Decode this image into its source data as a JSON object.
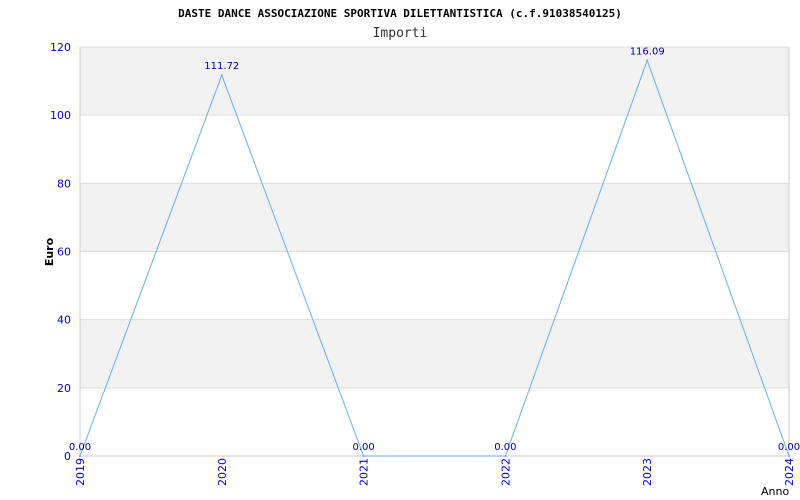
{
  "chart_data": {
    "type": "line",
    "title": "DASTE DANCE ASSOCIAZIONE SPORTIVA DILETTANTISTICA (c.f.91038540125)",
    "subtitle": "Importi",
    "xlabel": "Anno",
    "ylabel": "Euro",
    "categories": [
      "2019",
      "2020",
      "2021",
      "2022",
      "2023",
      "2024"
    ],
    "values": [
      0,
      111.72,
      0,
      0,
      116.09,
      0
    ],
    "data_labels": [
      "0.00",
      "111.72",
      "0.00",
      "0.00",
      "116.09",
      "0.00"
    ],
    "y_ticks": [
      "0",
      "20",
      "40",
      "60",
      "80",
      "100",
      "120"
    ],
    "ylim": [
      0,
      120
    ],
    "grid": true,
    "legend": "none",
    "colors": {
      "line": "#6aaee8",
      "band": "#f2f2f2",
      "grid": "#dddddd",
      "tick_text": "#0000cc",
      "label_text": "#000099"
    }
  }
}
